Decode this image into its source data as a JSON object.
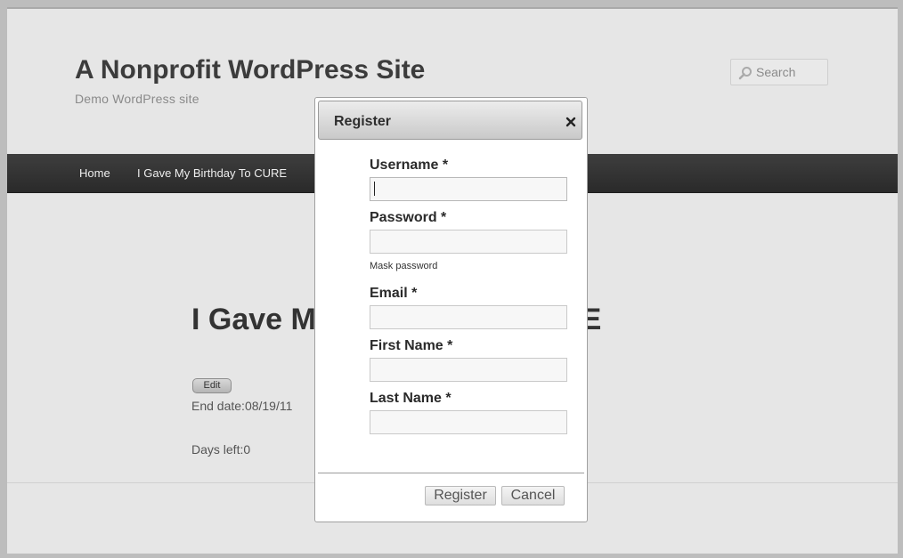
{
  "site": {
    "title": "A Nonprofit WordPress Site",
    "description": "Demo WordPress site"
  },
  "search": {
    "placeholder": "Search",
    "icon": "search-icon"
  },
  "nav": {
    "items": [
      {
        "label": "Home"
      },
      {
        "label": "I Gave My Birthday To CURE"
      }
    ]
  },
  "content": {
    "title": "I Gave My Birthday To CURE",
    "edit_label": "Edit",
    "end_date": "End date:08/19/11",
    "days_left": "Days left:0"
  },
  "dialog": {
    "title": "Register",
    "close_icon": "close-icon",
    "fields": [
      {
        "label": "Username *",
        "value": ""
      },
      {
        "label": "Password *",
        "value": ""
      },
      {
        "label": "Email *",
        "value": ""
      },
      {
        "label": "First Name *",
        "value": ""
      },
      {
        "label": "Last Name *",
        "value": ""
      }
    ],
    "mask_password_label": "Mask password",
    "register_button": "Register",
    "cancel_button": "Cancel"
  },
  "colors": {
    "page_bg": "#e6e6e6",
    "nav_bg": "#333333",
    "dialog_header": "#d4d4d4"
  }
}
